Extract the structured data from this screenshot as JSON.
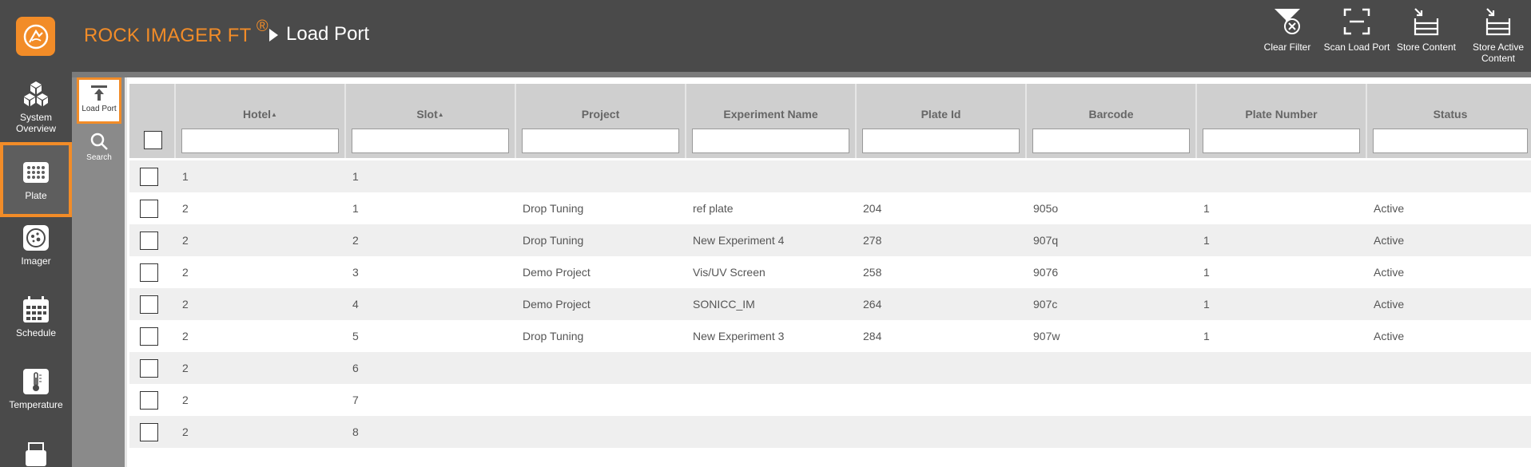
{
  "app": {
    "brand": "ROCK IMAGER FT",
    "brand_mark": "®",
    "page_title": "Load Port",
    "accent_color": "#f28c28"
  },
  "sidebar": {
    "items": [
      {
        "label_line1": "System",
        "label_line2": "Overview",
        "icon": "cubes-icon"
      },
      {
        "label_line1": "Plate",
        "label_line2": "",
        "icon": "plate-icon",
        "active": true
      },
      {
        "label_line1": "Imager",
        "label_line2": "",
        "icon": "imager-icon"
      },
      {
        "label_line1": "Schedule",
        "label_line2": "",
        "icon": "calendar-icon"
      },
      {
        "label_line1": "Temperature",
        "label_line2": "",
        "icon": "thermometer-icon"
      }
    ]
  },
  "toolbar": {
    "clear_filter": "Clear Filter",
    "scan_load_port": "Scan Load Port",
    "store_content": "Store Content",
    "store_active_line1": "Store Active",
    "store_active_line2": "Content"
  },
  "subnav": {
    "load_port": "Load Port",
    "search": "Search"
  },
  "table": {
    "columns": [
      "Hotel",
      "Slot",
      "Project",
      "Experiment Name",
      "Plate Id",
      "Barcode",
      "Plate Number",
      "Status"
    ],
    "sort_indicator": "▲",
    "rows": [
      [
        "1",
        "1",
        "",
        "",
        "",
        "",
        "",
        ""
      ],
      [
        "2",
        "1",
        "Drop Tuning",
        "ref plate",
        "204",
        "905o",
        "1",
        "Active"
      ],
      [
        "2",
        "2",
        "Drop Tuning",
        "New Experiment 4",
        "278",
        "907q",
        "1",
        "Active"
      ],
      [
        "2",
        "3",
        "Demo Project",
        "Vis/UV Screen",
        "258",
        "9076",
        "1",
        "Active"
      ],
      [
        "2",
        "4",
        "Demo Project",
        "SONICC_IM",
        "264",
        "907c",
        "1",
        "Active"
      ],
      [
        "2",
        "5",
        "Drop Tuning",
        "New Experiment 3",
        "284",
        "907w",
        "1",
        "Active"
      ],
      [
        "2",
        "6",
        "",
        "",
        "",
        "",
        "",
        ""
      ],
      [
        "2",
        "7",
        "",
        "",
        "",
        "",
        "",
        ""
      ],
      [
        "2",
        "8",
        "",
        "",
        "",
        "",
        "",
        ""
      ]
    ]
  }
}
